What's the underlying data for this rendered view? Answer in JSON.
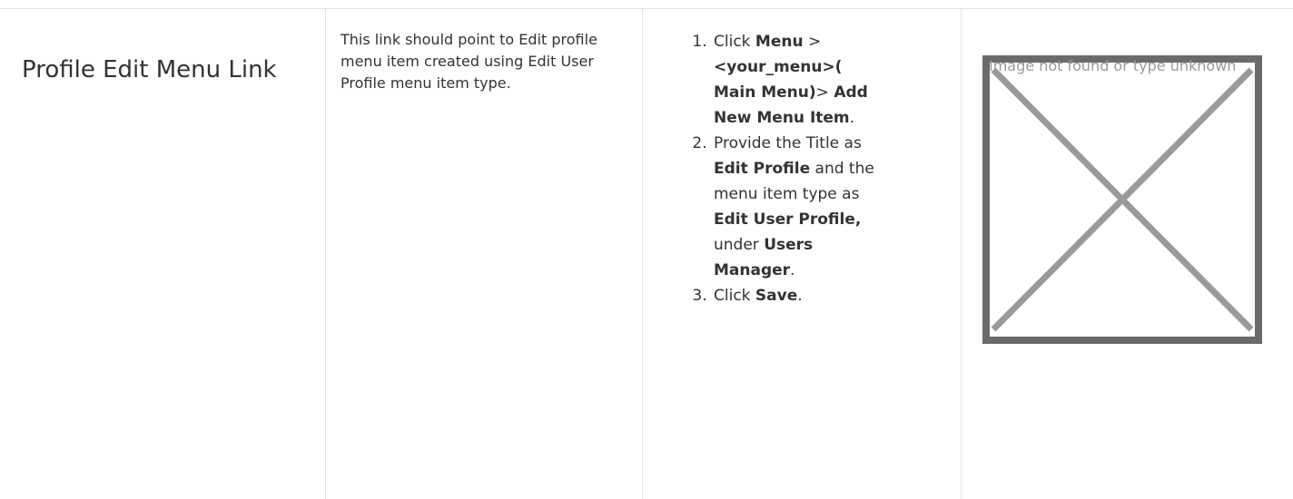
{
  "row": {
    "name": "Profile Edit Menu Link",
    "description": "This link should point to Edit profile menu item created using Edit User Profile menu item type.",
    "steps": [
      {
        "parts": [
          {
            "text": "Click ",
            "bold": false
          },
          {
            "text": "Menu",
            "bold": true
          },
          {
            "text": " > ",
            "bold": false
          },
          {
            "text": "<your_menu>( Main Menu)",
            "bold": true
          },
          {
            "text": "> ",
            "bold": false
          },
          {
            "text": "Add New Menu Item",
            "bold": true
          },
          {
            "text": ".",
            "bold": false
          }
        ]
      },
      {
        "parts": [
          {
            "text": "Provide the Title as ",
            "bold": false
          },
          {
            "text": "Edit Profile",
            "bold": true
          },
          {
            "text": " and the menu item type as ",
            "bold": false
          },
          {
            "text": "Edit User Profile,",
            "bold": true
          },
          {
            "text": " under ",
            "bold": false
          },
          {
            "text": "Users Manager",
            "bold": true
          },
          {
            "text": ".",
            "bold": false
          }
        ]
      },
      {
        "parts": [
          {
            "text": "Click ",
            "bold": false
          },
          {
            "text": "Save",
            "bold": true
          },
          {
            "text": ".",
            "bold": false
          }
        ]
      }
    ],
    "image_alt": "Image not found or type unknown",
    "image_icon": "broken-image-icon"
  }
}
